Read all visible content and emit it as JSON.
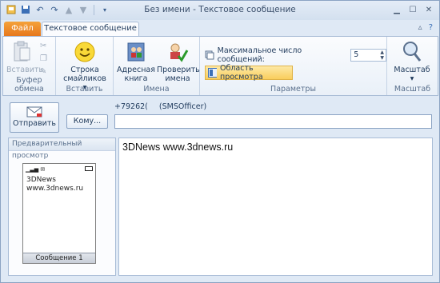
{
  "window": {
    "title": "Без имени  -  Текстовое сообщение"
  },
  "tabs": {
    "file": "Файл",
    "active": "Текстовое сообщение"
  },
  "ribbon": {
    "clipboard": {
      "paste_label": "Вставить",
      "group_label": "Буфер обмена"
    },
    "insert": {
      "smiley_label_1": "Строка",
      "smiley_label_2": "смайликов",
      "group_label": "Вставить"
    },
    "names": {
      "addressbook_1": "Адресная",
      "addressbook_2": "книга",
      "checknames_1": "Проверить",
      "checknames_2": "имена",
      "group_label": "Имена"
    },
    "params": {
      "max_messages_label": "Максимальное число сообщений:",
      "max_messages_value": "5",
      "preview_label": "Область просмотра",
      "group_label": "Параметры"
    },
    "zoom": {
      "label": "Масштаб",
      "group_label": "Масштаб"
    }
  },
  "compose": {
    "send_label": "Отправить",
    "to_label": "Кому...",
    "recipient_number": "+79262(",
    "recipient_service": "(SMSOfficer)",
    "to_value": ""
  },
  "preview": {
    "header": "Предварительный просмотр",
    "line1": "3DNews",
    "line2": "www.3dnews.ru",
    "footer": "Сообщение 1"
  },
  "message": {
    "body": "3DNews www.3dnews.ru"
  },
  "colors": {
    "file_tab": "#e6781d",
    "preview_highlight": "#f9cd5c",
    "frame": "#8ba3c3"
  }
}
